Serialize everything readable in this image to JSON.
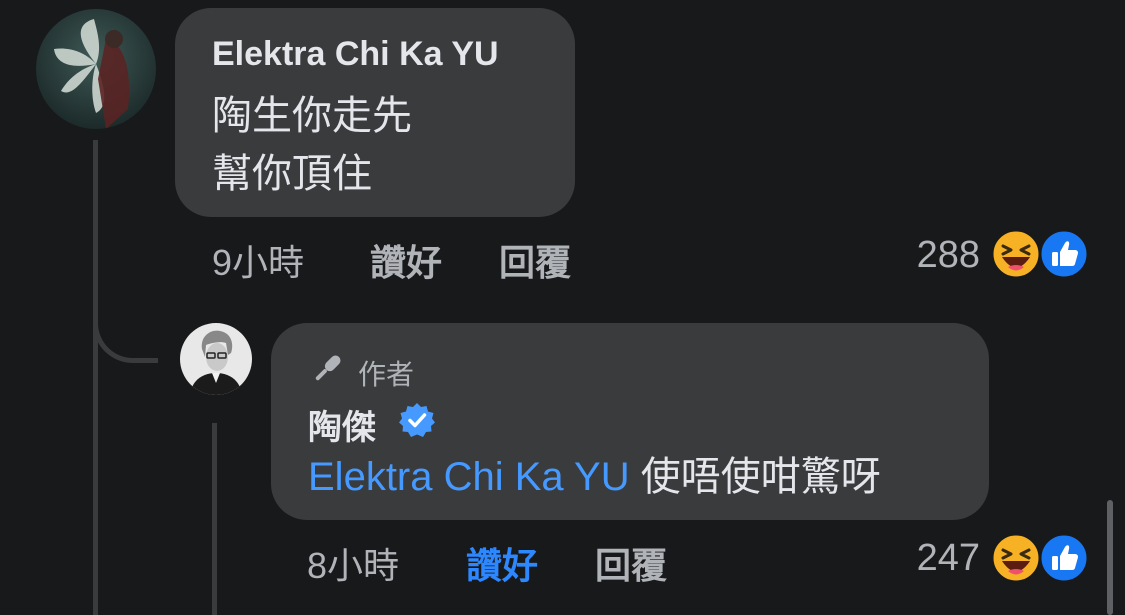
{
  "comment": {
    "author": "Elektra Chi Ka YU",
    "lines": [
      "陶生你走先",
      "幫你頂住"
    ],
    "time": "9小時",
    "like_label": "讚好",
    "reply_label": "回覆",
    "reaction_count": "288",
    "reactions": [
      "haha-icon",
      "like-icon"
    ]
  },
  "reply": {
    "author_badge": "作者",
    "author": "陶傑",
    "verified": true,
    "mention": "Elektra Chi Ka YU",
    "text": "使唔使咁驚呀",
    "time": "8小時",
    "like_label": "讚好",
    "like_active": true,
    "reply_label": "回覆",
    "reaction_count": "247",
    "reactions": [
      "haha-icon",
      "like-icon"
    ]
  },
  "colors": {
    "background": "#18191a",
    "bubble": "#3a3b3c",
    "accent": "#2d88ff",
    "mention": "#4599ff",
    "like_badge": "#1877f2",
    "haha_face": "#f7b125"
  }
}
